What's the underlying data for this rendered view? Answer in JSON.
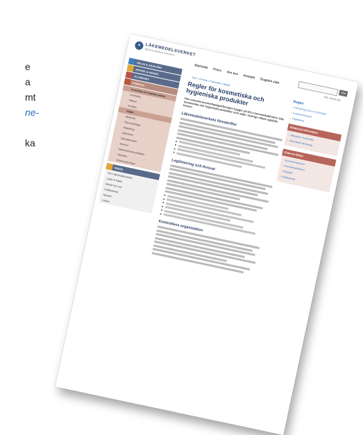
{
  "edge_text": [
    "e",
    "a",
    "mt",
    "ne-",
    "",
    "ka"
  ],
  "sheet": {
    "logo_text": "LÄKEMEDELSVERKET",
    "logo_sub": "MEDICAL PRODUCTS AGENCY",
    "topnav": [
      "Startsida",
      "Press",
      "Om oss",
      "Kontakt",
      "Engelsk sida"
    ],
    "search_button": "Sök",
    "search_radio": "Sök i denna del",
    "left_nav": [
      {
        "label": "HÄLSA & SJUKVÅRD",
        "color": "#3f7fbf"
      },
      {
        "label": "APOTEK & HANDEL",
        "color": "#e0a830"
      },
      {
        "label": "ALLMÄNHET",
        "color": "#c0504d"
      },
      {
        "label": "FÖRETAG",
        "color": "#b8563f",
        "selected": true
      }
    ],
    "left_sub": [
      {
        "label": "Kosmetika och hygienprodukter",
        "hi": true
      },
      {
        "label": "Kosmetika"
      },
      {
        "label": "Allmänt"
      },
      {
        "label": "Anmälan"
      },
      {
        "label": "Regler",
        "hi": true
      },
      {
        "label": "Allergener"
      },
      {
        "label": "Tatueringsfärger"
      },
      {
        "label": "Vägledning"
      },
      {
        "label": "Läkemedel"
      },
      {
        "label": "Naturläkemedel"
      },
      {
        "label": "Vacciner"
      },
      {
        "label": "Medicintekniska produkter"
      },
      {
        "label": "Narkotika"
      },
      {
        "label": "Kliniska prövningar"
      }
    ],
    "left_group_header": "PRESS",
    "left_group": [
      "Om Läkemedelsverket",
      "Lagar & regler",
      "Arbeta hos oss",
      "Publikationer",
      "Nyheter",
      "Länkar"
    ],
    "breadcrumb": "Start > Företag > Kosmetika > Regler",
    "title": "Regler för kosmetiska och hygieniska produkter",
    "lead": "Den svenska kosmetikalagstiftningen bygger på EU:s kosmetikadirektiv. Alla kosmetiska och hygieniska produkter som säljs i Sverige måste uppfylla kraven.",
    "sections": [
      {
        "heading": "Läkemedelsverkets föreskrifter",
        "lines": 6,
        "bullets": 4
      },
      {
        "heading": "Legitimering och Ansvar",
        "lines": 8,
        "bullets": 6
      },
      {
        "heading": "Kontrollens organisation",
        "lines": 8,
        "bullets": 0
      }
    ],
    "right": {
      "heading": "Regler",
      "links": [
        "Förordning (EG) nr 1223/2009",
        "Konsumentverket",
        "Vägledning"
      ],
      "box1_title": "Relaterad information",
      "box1_links": [
        "Allergener i kosmetika",
        "Information till företag"
      ],
      "box2_title": "Externa länkar",
      "box2_links": [
        "EU-kommissionen",
        "Kosmetikadirektivet",
        "Regelrätt",
        "Publikationer"
      ]
    }
  }
}
